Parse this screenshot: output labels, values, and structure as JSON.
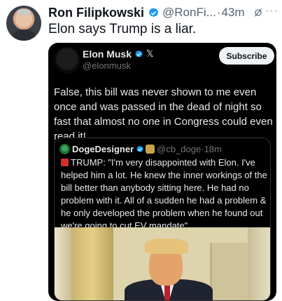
{
  "post": {
    "author_name": "Ron Filipkowski",
    "author_handle": "@RonFi...",
    "separator": "·",
    "time": "43m",
    "more": "···",
    "text": "Elon says Trump is a liar."
  },
  "embed": {
    "author_name": "Elon Musk",
    "author_handle": "@elonmusk",
    "x_label": "𝕏",
    "subscribe_label": "Subscribe",
    "text": "False, this bill was never shown to me even once and was passed in the dead of night so fast that almost no one in Congress could even read it!"
  },
  "quote": {
    "author_name": "DogeDesigner",
    "author_handle": "@cb_doge",
    "separator": "·",
    "time": "18m",
    "text": "TRUMP: \"I'm very disappointed with Elon. I've helped him a lot. He knew the inner workings of the bill better than anybody sitting here. He had no problem with it. All of a sudden he had a problem & he only developed the problem when he found out we're going to cut EV mandate\""
  },
  "colors": {
    "verified_blue": "#1d9bf0",
    "embed_background": "#000000",
    "secondary_text": "#536471"
  },
  "icons": [
    "verified-badge-icon",
    "grok-icon",
    "more-icon",
    "x-logo-icon",
    "doge-icon",
    "flag-icon"
  ]
}
